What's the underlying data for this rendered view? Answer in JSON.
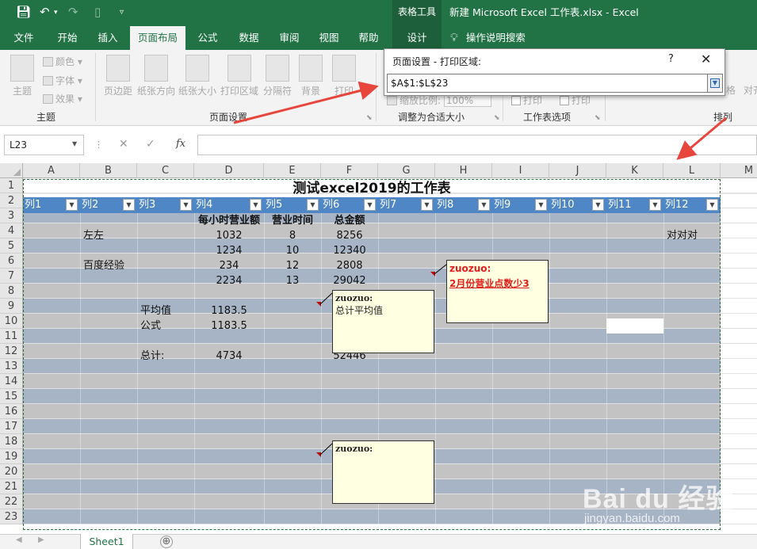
{
  "titlebar": {
    "tools_label": "表格工具",
    "doc_title": "新建 Microsoft Excel 工作表.xlsx  -  Excel"
  },
  "tabs": [
    "文件",
    "开始",
    "插入",
    "页面布局",
    "公式",
    "数据",
    "审阅",
    "视图",
    "帮助",
    "设计"
  ],
  "search_tab": "操作说明搜索",
  "ribbon": {
    "theme_btn": "主题",
    "colors": "颜色",
    "fonts": "字体",
    "effects": "效果",
    "margins": "页边距",
    "orientation": "纸张方向",
    "size": "纸张大小",
    "print_area": "打印区域",
    "breaks": "分隔符",
    "background": "背景",
    "print_titles": "打印",
    "scale_label": "缩放比例:",
    "scale_value": "100%",
    "print_chk1": "打印",
    "print_chk2": "打印",
    "right_frag1": "格",
    "right_frag2": "对齐",
    "groups": [
      "主题",
      "页面设置",
      "调整为合适大小",
      "工作表选项",
      "排列"
    ]
  },
  "dialog": {
    "title": "页面设置 - 打印区域:",
    "help": "?",
    "close": "✕",
    "value": "$A$1:$L$23"
  },
  "formula_bar": {
    "name_box": "L23",
    "fx": "fx",
    "formula": ""
  },
  "columns": [
    "A",
    "B",
    "C",
    "D",
    "E",
    "F",
    "G",
    "H",
    "I",
    "J",
    "K",
    "L",
    "M"
  ],
  "rows": [
    "1",
    "2",
    "3",
    "4",
    "5",
    "6",
    "7",
    "8",
    "9",
    "10",
    "11",
    "12",
    "13",
    "14",
    "15",
    "16",
    "17",
    "18",
    "19",
    "20",
    "21",
    "22",
    "23"
  ],
  "sheet": {
    "title": "测试excel2019的工作表",
    "table_headers": [
      "列1",
      "列2",
      "列3",
      "列4",
      "列5",
      "列6",
      "列7",
      "列8",
      "列9",
      "列10",
      "列11",
      "列12"
    ],
    "subheaders": {
      "d": "每小时营业额",
      "e": "营业时间",
      "f": "总金额"
    },
    "r4": {
      "b": "左左",
      "d": "1032",
      "e": "8",
      "f": "8256",
      "l": "对对对"
    },
    "r5": {
      "d": "1234",
      "e": "10",
      "f": "12340"
    },
    "r6": {
      "b": "百度经验",
      "d": "234",
      "e": "12",
      "f": "2808"
    },
    "r7": {
      "d": "2234",
      "e": "13",
      "f": "29042"
    },
    "r9": {
      "c": "平均值",
      "d": "1183.5"
    },
    "r10": {
      "c": "公式",
      "d": "1183.5"
    },
    "r12": {
      "c": "总计:",
      "d": "4734",
      "f": "52446"
    }
  },
  "comments": {
    "c1": {
      "author": "zuozuo:",
      "text": "2月份营业点数少3"
    },
    "c2": {
      "author": "zuozuo:",
      "text": "总计平均值"
    },
    "c3": {
      "author": "zuozuo:",
      "text": ""
    }
  },
  "sheet_tab": "Sheet1",
  "add_sheet": "⊕",
  "watermark": {
    "logo": "Bai du 经验",
    "sub": "jingyan.baidu.com"
  },
  "colors": {
    "excel_green": "#217346",
    "header_blue": "#4f86c6",
    "band_a": "#a6b4c6",
    "band_b": "#c3c3c3",
    "comment_bg": "#ffffe1",
    "arrow_red": "#e8463c"
  }
}
